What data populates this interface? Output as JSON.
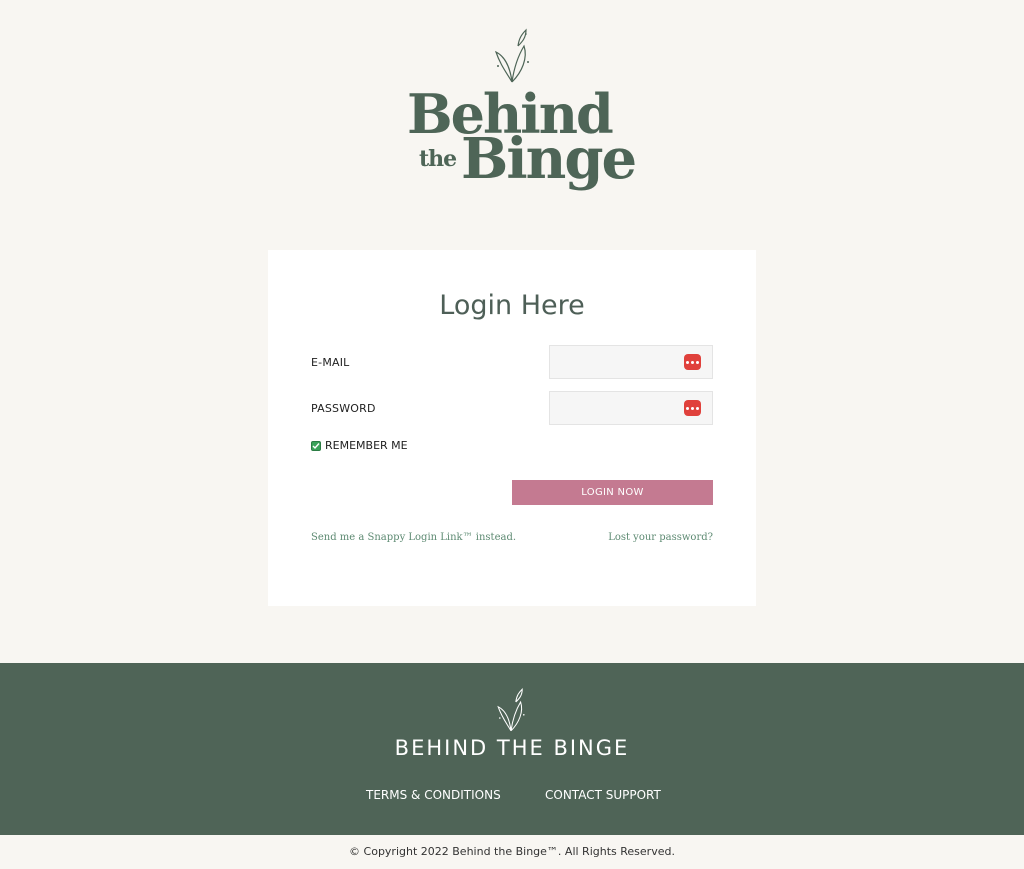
{
  "brand": {
    "logo_word_1": "Behind",
    "logo_word_2": "the",
    "logo_word_3": "Binge",
    "accent_color": "#4e6557"
  },
  "login": {
    "title": "Login Here",
    "email_label": "E-MAIL",
    "email_value": "",
    "password_label": "PASSWORD",
    "password_value": "",
    "remember_label": "REMEMBER ME",
    "remember_checked": true,
    "submit_label": "LOGIN NOW",
    "snappy_link": "Send me a Snappy Login Link™ instead.",
    "lost_password_link": "Lost your password?",
    "button_color": "#c47a91",
    "password_manager_icon": "password-manager-icon"
  },
  "footer": {
    "brand": "BEHIND THE BINGE",
    "terms_link": "TERMS & CONDITIONS",
    "support_link": "CONTACT SUPPORT",
    "copyright": "© Copyright 2022 Behind the Binge™. All Rights Reserved.",
    "background_color": "#4f6457"
  }
}
